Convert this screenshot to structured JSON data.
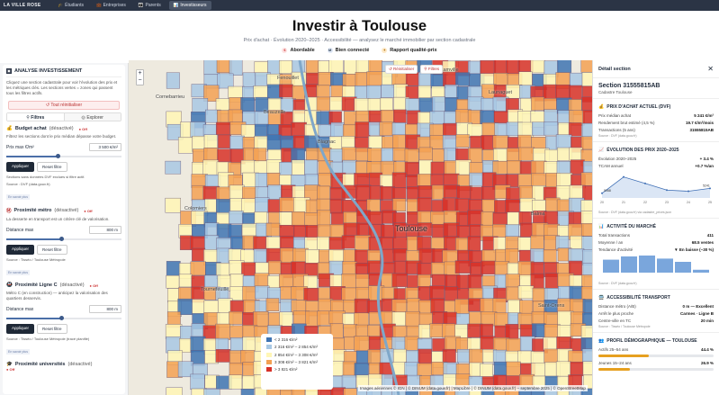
{
  "nav": {
    "brand": "LA VILLE ROSE",
    "tabs": [
      {
        "label": "Étudiants"
      },
      {
        "label": "Entreprises"
      },
      {
        "label": "Parents"
      },
      {
        "label": "Investisseurs"
      }
    ]
  },
  "hero": {
    "title": "Investir à Toulouse",
    "subtitle": "Prix d'achat · Évolution 2020–2025 · Accessibilité — analysez le marché immobilier par section cadastrale",
    "chips": [
      "Abordable",
      "Bien connecté",
      "Rapport qualité-prix"
    ]
  },
  "left": {
    "header": "ANALYSE INVESTISSEMENT",
    "intro": "Cliquez une section cadastrale pour voir l'évolution des prix et les métriques clés. Les sections vertes = zones qui passent tous les filtres actifs.",
    "reset": "Tout réinitialiser",
    "tab_filters": "Filtres",
    "tab_explore": "Explorer",
    "budget": {
      "title": "Budget achat",
      "state": "(désactivé)",
      "off": "Off",
      "desc": "Filtrez les sections dont le prix médian dépasse votre budget.",
      "label": "Prix max €/m²",
      "value": "3 500 €/m²",
      "level": 0.45,
      "note": "Sections sans données DVF exclues si filtre actif.",
      "source": "Source : DVF (data.gouv.fr)"
    },
    "metro": {
      "title": "Proximité métro",
      "state": "(désactivé)",
      "off": "Off",
      "desc": "La desserte en transport est un critère clé de valorisation.",
      "label": "Distance max",
      "value": "800 m",
      "level": 0.48,
      "source": "Source : Tisséo / Toulouse Métropole"
    },
    "lignec": {
      "title": "Proximité Ligne C",
      "state": "(désactivé)",
      "off": "Off",
      "desc": "Métro C (en construction) — anticipez la valorisation des quartiers desservis.",
      "label": "Distance max",
      "value": "800 m",
      "level": 0.48,
      "source": "Source : Tisséo / Toulouse Métropole (tracé planifié)"
    },
    "univ": {
      "title": "Proximité universités",
      "state": "(désactivé)",
      "off": "Off"
    },
    "apply": "Appliquer",
    "resetf": "Reset filtre",
    "more": "En savoir plus"
  },
  "map": {
    "reset": "Réinitialiser",
    "filters": "Filtres",
    "zoom_in": "+",
    "zoom_out": "−",
    "places": [
      "Fenouillet",
      "Aucamville",
      "Launaguet",
      "Cornebarrieu",
      "Blagnac",
      "Beauzelle",
      "Colomiers",
      "Toulouse",
      "Balma",
      "Tournefeuille",
      "Saint-Orens"
    ],
    "legend": [
      "< 2 316 €/m²",
      "2 316 €/m² – 2 854 €/m²",
      "2 854 €/m² – 3 308 €/m²",
      "3 308 €/m² – 3 821 €/m²",
      "> 3 821 €/m²"
    ],
    "legend_colors": [
      "#3e74b3",
      "#a8c8e4",
      "#fff6b6",
      "#f3a153",
      "#d73128"
    ],
    "attribution": "Images aériennes © IGN | © DINUM (data.gouv.fr) | MapLibre | © DINUM (data.gouv.fr) – septembre 2025 | © OpenStreetMap"
  },
  "right": {
    "header": "Détail section",
    "title": "Section 31555815AB",
    "commune": "Cadastre Toulouse",
    "prix": {
      "title": "PRIX D'ACHAT ACTUEL (DVF)",
      "rows": [
        [
          "Prix médian achat",
          "5 241 €/m²"
        ],
        [
          "Rendement brut estimé (4,5 %)",
          "19.7 €/m²/mois"
        ],
        [
          "Transactions (5 ans)",
          "31555815AB"
        ]
      ],
      "src": "Source : DVF (data.gouv.fr)"
    },
    "evol": {
      "title": "ÉVOLUTION DES PRIX 2020–2025",
      "rows": [
        [
          "Évolution 2020–2025",
          "+ 3.4 %"
        ],
        [
          "TCAM annuel",
          "+0.7 %/an"
        ]
      ],
      "src": "Source : DVF (data.gouv.fr) via cadastre_prices.json"
    },
    "activite": {
      "title": "ACTIVITÉ DU MARCHÉ",
      "rows": [
        [
          "Total transactions",
          "411"
        ],
        [
          "Moyenne / an",
          "68.5 ventes"
        ],
        [
          "Tendance d'activité",
          "▼ En baisse (−30 %)"
        ]
      ],
      "src": "Source : DVF (data.gouv.fr)"
    },
    "access": {
      "title": "ACCESSIBILITÉ TRANSPORT",
      "rows": [
        [
          "Distance métro (A/B)",
          "0 m — Excellent"
        ],
        [
          "Arrêt le plus proche",
          "Carmes · Ligne B"
        ],
        [
          "Centre-ville en TC",
          "20 min"
        ]
      ],
      "src": "Source : Tisséo / Toulouse Métropole"
    },
    "demo": {
      "title": "PROFIL DÉMOGRAPHIQUE — TOULOUSE",
      "rows": [
        {
          "label": "Actifs 25–54 ans",
          "value": "44.4 %",
          "level": 0.44
        },
        {
          "label": "Jeunes 15–24 ans",
          "value": "26.9 %",
          "level": 0.27
        }
      ]
    }
  },
  "chart_data": [
    {
      "type": "line",
      "title": "",
      "x": [
        2020,
        2021,
        2022,
        2023,
        2024,
        2025
      ],
      "xlabel": "",
      "ylabel": "",
      "series": [
        {
          "values": [
            5068,
            5650,
            5420,
            5180,
            5140,
            5241
          ]
        }
      ],
      "labels": [
        "5068",
        "5241"
      ],
      "ylim": [
        4900,
        5800
      ]
    },
    {
      "type": "bar",
      "title": "",
      "categories": [
        "2020",
        "2021",
        "2022",
        "2023",
        "2024",
        "2025"
      ],
      "series": [
        {
          "values": [
            72,
            90,
            95,
            78,
            60,
            16
          ]
        }
      ],
      "ylim": [
        0,
        100
      ]
    }
  ],
  "colors": {
    "accent": "#1f2937",
    "nav": "#2b3445",
    "danger": "#c0392b"
  }
}
